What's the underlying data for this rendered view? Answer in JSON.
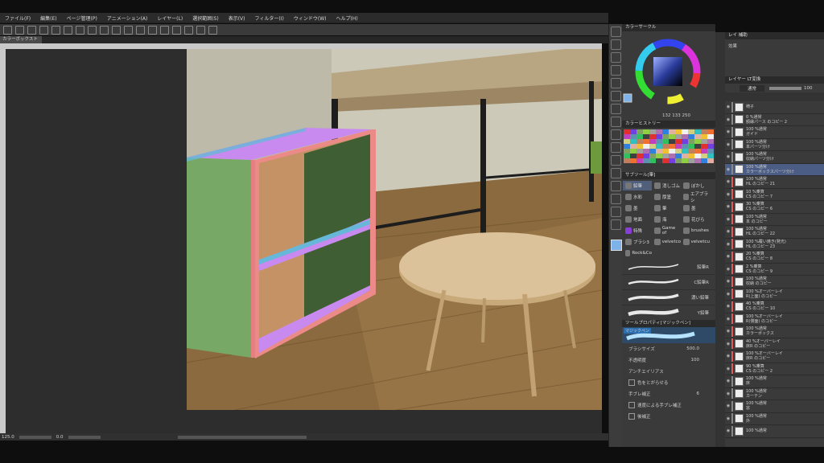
{
  "menu": [
    "ファイル(F)",
    "編集(E)",
    "ページ管理(P)",
    "アニメーション(A)",
    "レイヤー(L)",
    "選択範囲(S)",
    "表示(V)",
    "フィルター(I)",
    "ウィンドウ(W)",
    "ヘルプ(H)"
  ],
  "tab_title": "カラーボックスト",
  "status": {
    "zoom": "125.0",
    "angle": "0.0"
  },
  "color_panel": {
    "title": "カラーサークル",
    "values": "132  133  250"
  },
  "history_title": "カラーヒストリー",
  "subtool": {
    "title": "サブツール[筆]",
    "buttons": [
      "鉛筆",
      "消しゴム",
      "ぼかし",
      "水彩",
      "厚塗",
      "エアブラシ",
      "墨",
      "筆",
      "墨",
      "地面",
      "海",
      "花びら",
      "特殊",
      "Game of",
      "brushes",
      "ブラシ3",
      "velvetco",
      "velvetcu",
      "Rock&Co"
    ],
    "brushes": [
      "鉛筆R",
      "C鉛筆R",
      "濃い鉛筆",
      "Y鉛筆",
      "マジックペン"
    ]
  },
  "tool_property": {
    "title": "ツールプロパティ[マジックペン]",
    "tool_name": "マジックペン",
    "brush_size_label": "ブラシサイズ",
    "brush_size": "500.0",
    "opacity_label": "不透明度",
    "opacity": "100",
    "antialias_label": "アンチエイリアス",
    "lock_label": "色をとがらせる",
    "stabilize_label": "手ブレ補正",
    "stabilize": "6",
    "speed_label": "速度による手ブレ補正",
    "post_label": "後補正"
  },
  "effect_panel": {
    "tab1": "レイ",
    "tab2": "補助",
    "label": "効果"
  },
  "layer_panel": {
    "tab1": "レイヤー",
    "tab2": "LT変換",
    "blend": "通常",
    "opacity": "100",
    "layers": [
      {
        "l1": "椅子",
        "l2": "",
        "color": "#888888"
      },
      {
        "l1": "0 %通常",
        "l2": "額縁パース のコピー 2",
        "color": "#888888"
      },
      {
        "l1": "100 %通常",
        "l2": "ガイド",
        "color": "#888888"
      },
      {
        "l1": "100 %通常",
        "l2": "本パーツ分け",
        "color": "#888888"
      },
      {
        "l1": "100 %通常",
        "l2": "収納パーツ分け",
        "color": "#888888"
      },
      {
        "l1": "100 %通常",
        "l2": "カラーボックスパーツ分け",
        "color": "#888888"
      },
      {
        "l1": "100 %通常",
        "l2": "HL のコピー 21",
        "color": "#e05a5a"
      },
      {
        "l1": "10 %乗算",
        "l2": "CS のコピー 7",
        "color": "#e05a5a"
      },
      {
        "l1": "30 %乗算",
        "l2": "CS のコピー 6",
        "color": "#e05a5a"
      },
      {
        "l1": "100 %通常",
        "l2": "本 のコピー",
        "color": "#e05a5a"
      },
      {
        "l1": "100 %通常",
        "l2": "HL のコピー 22",
        "color": "#e05a5a"
      },
      {
        "l1": "100 %覆い焼き(発光)",
        "l2": "HL のコピー 23",
        "color": "#e05a5a"
      },
      {
        "l1": "20 %乗算",
        "l2": "CS のコピー 8",
        "color": "#e05a5a"
      },
      {
        "l1": "2 %乗算",
        "l2": "CS のコピー 9",
        "color": "#e05a5a"
      },
      {
        "l1": "100 %通常",
        "l2": "収納 のコピー",
        "color": "#e05a5a"
      },
      {
        "l1": "100 %オーバーレイ",
        "l2": "R(上面) のコピー",
        "color": "#e05a5a"
      },
      {
        "l1": "40 %乗算",
        "l2": "CS のコピー 10",
        "color": "#e05a5a"
      },
      {
        "l1": "100 %オーバーレイ",
        "l2": "R(側面) のコピー",
        "color": "#e05a5a"
      },
      {
        "l1": "100 %通常",
        "l2": "カラーボックス",
        "color": "#e05a5a"
      },
      {
        "l1": "40 %オーバーレイ",
        "l2": "床R のコピー",
        "color": "#e05a5a"
      },
      {
        "l1": "100 %オーバーレイ",
        "l2": "床R のコピー",
        "color": "#e05a5a"
      },
      {
        "l1": "90 %乗算",
        "l2": "CS のコピー 2",
        "color": "#e05a5a"
      },
      {
        "l1": "100 %通常",
        "l2": "床",
        "color": "#888888"
      },
      {
        "l1": "100 %通常",
        "l2": "カーテン",
        "color": "#888888"
      },
      {
        "l1": "100 %通常",
        "l2": "窓",
        "color": "#888888"
      },
      {
        "l1": "100 %通常",
        "l2": "外",
        "color": "#888888"
      },
      {
        "l1": "100 %通常",
        "l2": "",
        "color": "#888888"
      }
    ]
  },
  "colors": {
    "accent": "#4a90d9",
    "selected_layer": "#4b5d84",
    "highlight_red": "#e05a5a"
  }
}
